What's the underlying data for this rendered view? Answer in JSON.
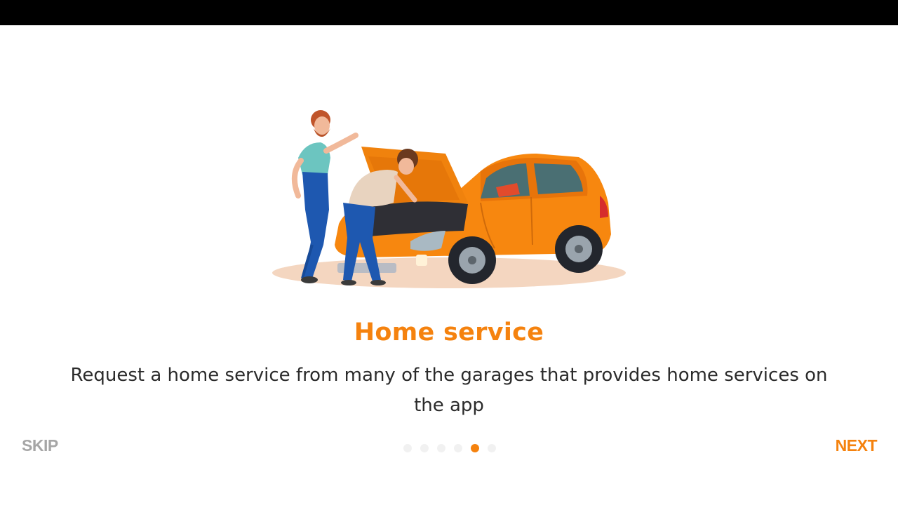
{
  "onboarding": {
    "title": "Home service",
    "description": "Request a home service from many of the garages that provides home services on the app",
    "skip_label": "SKIP",
    "next_label": "NEXT",
    "page_count": 6,
    "active_page": 5,
    "illustration_icon": "mechanics-repairing-car-illustration"
  },
  "colors": {
    "accent": "#f5820e",
    "skip": "#a6a6a6",
    "status_bar": "#000000",
    "dot_inactive": "#f1f1f1"
  }
}
